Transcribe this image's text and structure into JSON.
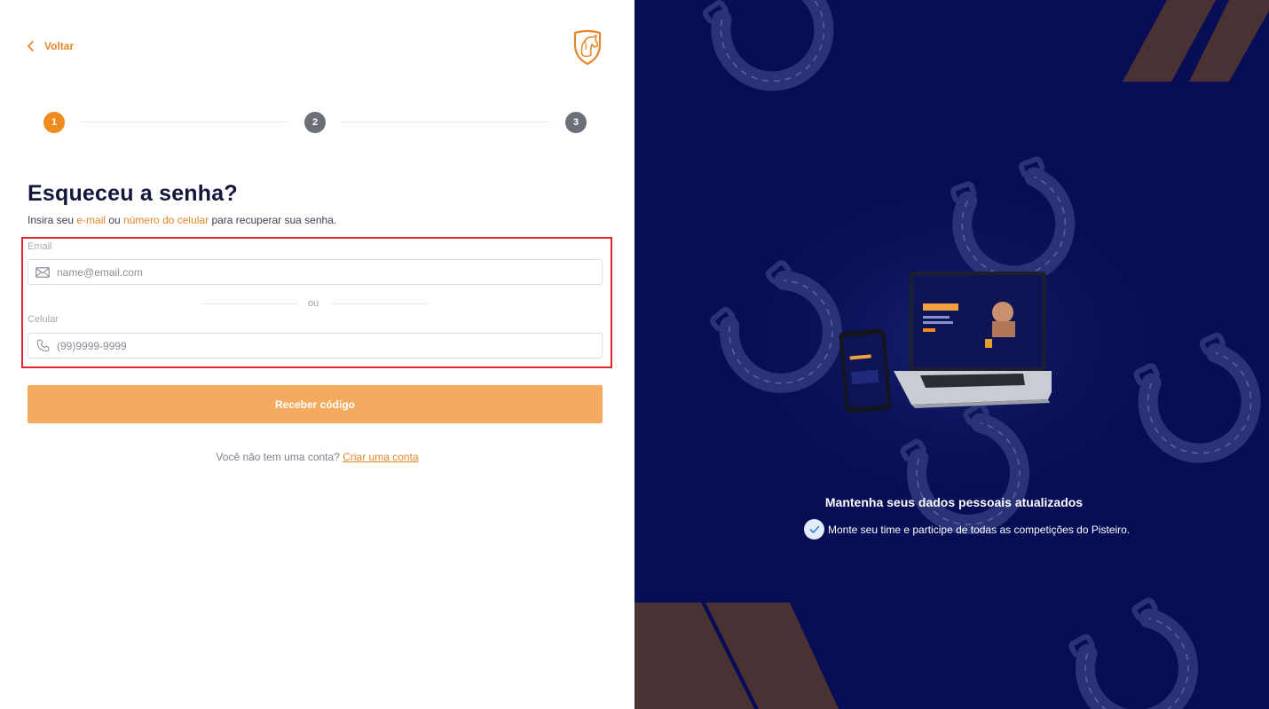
{
  "nav": {
    "back_label": "Voltar"
  },
  "stepper": {
    "steps": [
      "1",
      "2",
      "3"
    ],
    "active_step": 1
  },
  "form": {
    "title": "Esqueceu a senha?",
    "subtitle": {
      "prefix": "Insira seu ",
      "email_link": "e-mail",
      "middle": " ou ",
      "phone_link": "número do celular",
      "suffix": " para recuperar sua senha."
    },
    "email": {
      "label": "Email",
      "placeholder": "name@email.com"
    },
    "separator": "ou",
    "phone": {
      "label": "Celular",
      "placeholder": "(99)9999-9999"
    },
    "submit_label": "Receber código",
    "signup": {
      "prompt": "Você não tem uma conta? ",
      "link": "Criar uma conta"
    }
  },
  "promo": {
    "title": "Mantenha seus dados pessoais atualizados",
    "items": [
      "Monte seu time e participe de todas as competições do Pisteiro."
    ]
  },
  "colors": {
    "accent": "#e8862a",
    "step_active": "#ef8a1e",
    "step_inactive": "#6b6f78",
    "button": "#f4ab60",
    "panel_bg": "#070e55",
    "highlight_border": "#e0242c",
    "stripe": "#4a3134"
  },
  "icons": {
    "back": "chevron-left-icon",
    "logo": "horse-shield-logo",
    "email": "envelope-icon",
    "phone": "phone-icon",
    "check": "check-icon"
  }
}
